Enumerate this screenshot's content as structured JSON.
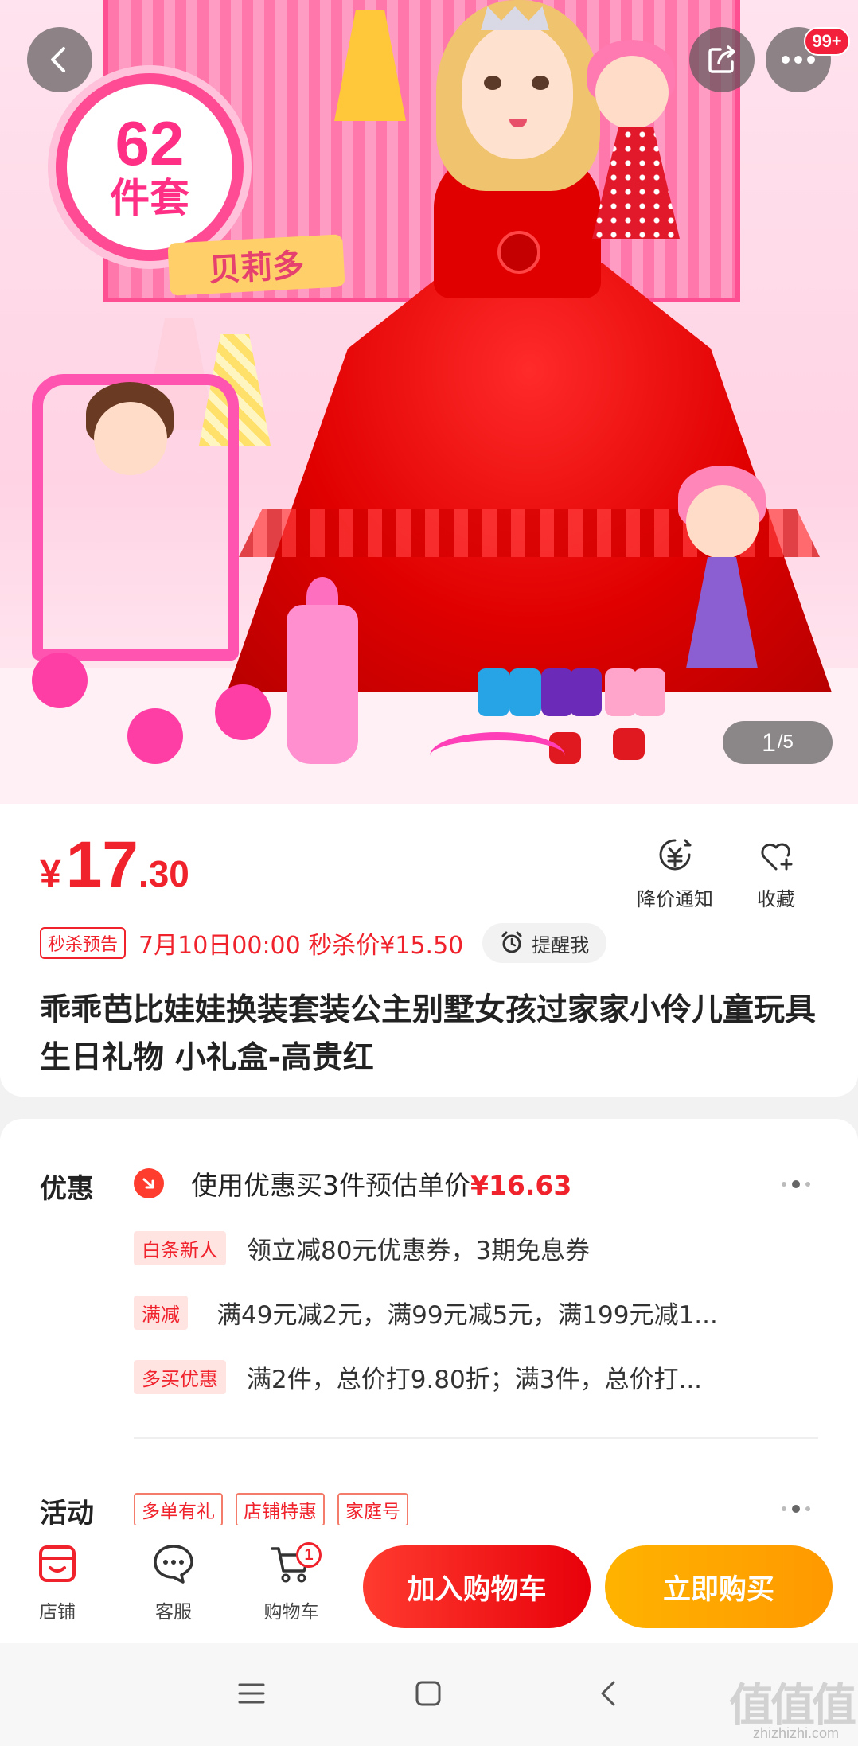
{
  "hero": {
    "badge_number": "62",
    "badge_text": "件套",
    "brand_text": "贝莉多",
    "notification_count": "99+",
    "image_current": "1",
    "image_total": "/5"
  },
  "product": {
    "currency": "¥",
    "price_integer": "17",
    "price_decimal": ".30",
    "price_alert_label": "降价通知",
    "favorite_label": "收藏",
    "seckill_tag": "秒杀预告",
    "seckill_text": "7月10日00:00 秒杀价¥15.50",
    "remind_label": "提醒我",
    "title": "乖乖芭比娃娃换装套装公主别墅女孩过家家小伶儿童玩具生日礼物 小礼盒-高贵红"
  },
  "promotions": {
    "label": "优惠",
    "hint_prefix": "使用优惠买3件预估单价",
    "hint_price": "¥16.63",
    "lines": [
      {
        "tag": "白条新人",
        "text": "领立减80元优惠券，3期免息券"
      },
      {
        "tag": "满减",
        "text": "满49元减2元，满99元减5元，满199元减1..."
      },
      {
        "tag": "多买优惠",
        "text": "满2件，总价打9.80折；满3件，总价打..."
      }
    ],
    "activity_label": "活动",
    "activity_tags": [
      "多单有礼",
      "店铺特惠",
      "家庭号"
    ]
  },
  "bottom_bar": {
    "store_label": "店铺",
    "service_label": "客服",
    "cart_label": "购物车",
    "cart_count": "1",
    "add_to_cart_label": "加入购物车",
    "buy_now_label": "立即购买"
  },
  "watermark": {
    "main": "值值值",
    "sub": "zhizhizhi.com"
  },
  "colors": {
    "accent_red": "#f0232d",
    "buy_orange": "#ffa800",
    "hero_pink": "#ff4f93"
  }
}
